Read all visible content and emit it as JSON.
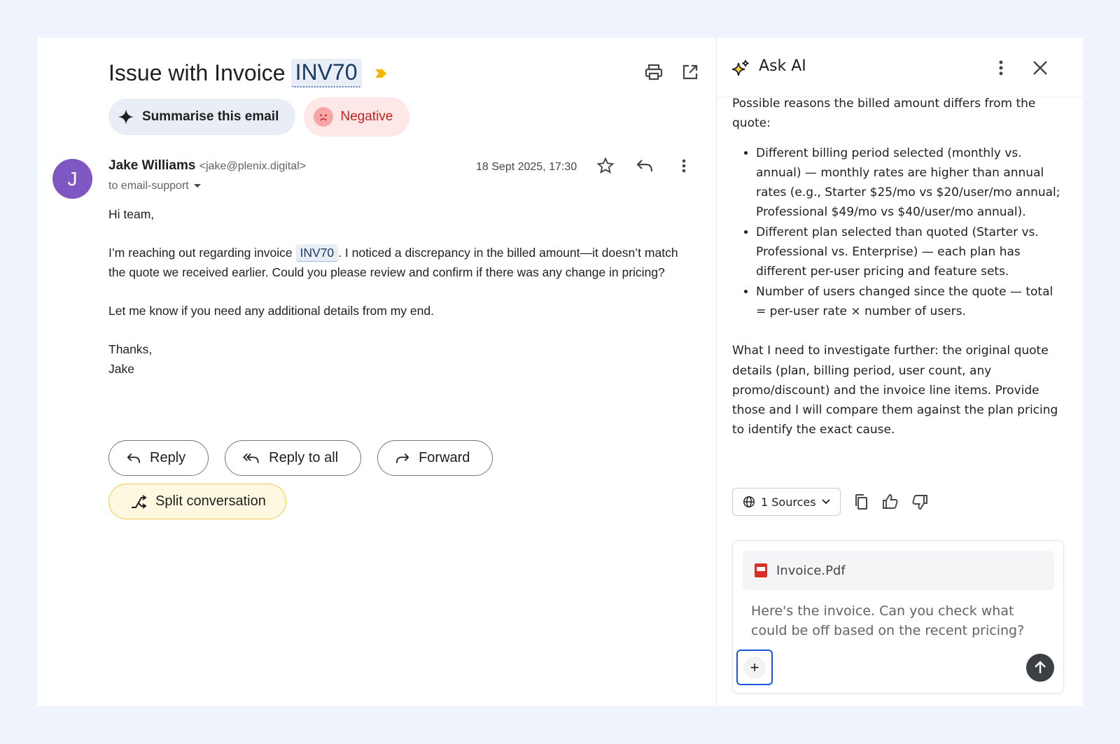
{
  "email": {
    "subject": "Issue with Invoice",
    "invoice_chip": "INV70",
    "summarise_label": "Summarise this email",
    "sentiment_label": "Negative",
    "sender": {
      "avatar_letter": "J",
      "name": "Jake Williams",
      "email": "<jake@plenix.digital>",
      "to": "to email-support",
      "date": "18 Sept 2025, 17:30"
    },
    "body": {
      "greeting": "Hi team,",
      "p1_before": "I’m reaching out regarding invoice ",
      "p1_chip": "INV70",
      "p1_after": ". I noticed a discrepancy in the billed amount—it doesn’t match the quote we received earlier. Could you please review and confirm if there was any change in pricing?",
      "p2": "Let me know if you need any additional details from my end.",
      "signoff": "Thanks,",
      "signature": "Jake"
    },
    "actions": {
      "reply": "Reply",
      "reply_all": "Reply to all",
      "forward": "Forward",
      "split": "Split conversation"
    },
    "icons": [
      "printer-icon",
      "open-in-new-icon",
      "star-icon",
      "reply-icon",
      "more-vert-icon",
      "importance-marker-icon"
    ]
  },
  "ai_panel": {
    "title": "Ask AI",
    "intro": "Possible reasons the billed amount differs from the quote:",
    "bullets": [
      "Different billing period selected (monthly vs. annual) — monthly rates are higher than annual rates (e.g., Starter $25/mo vs $20/user/mo annual; Professional $49/mo vs $40/user/mo annual).",
      "Different plan selected than quoted (Starter vs. Professional vs. Enterprise) — each plan has different per-user pricing and feature sets.",
      "Number of users changed since the quote — total = per-user rate × number of users."
    ],
    "followup": "What I need to investigate further: the original quote details (plan, billing period, user count, any promo/discount) and the invoice line items. Provide those and I will compare them against the plan pricing to identify the exact cause.",
    "sources_label": "1 Sources",
    "attachment": "Invoice.Pdf",
    "prompt_text": "Here's the invoice. Can you check what could be off based on the recent pricing?",
    "colors": {
      "accent_blue": "#1a56db",
      "avatar_purple": "#7e57c2",
      "negative_red": "#c5221f",
      "split_yellow": "#f2c94c"
    }
  }
}
